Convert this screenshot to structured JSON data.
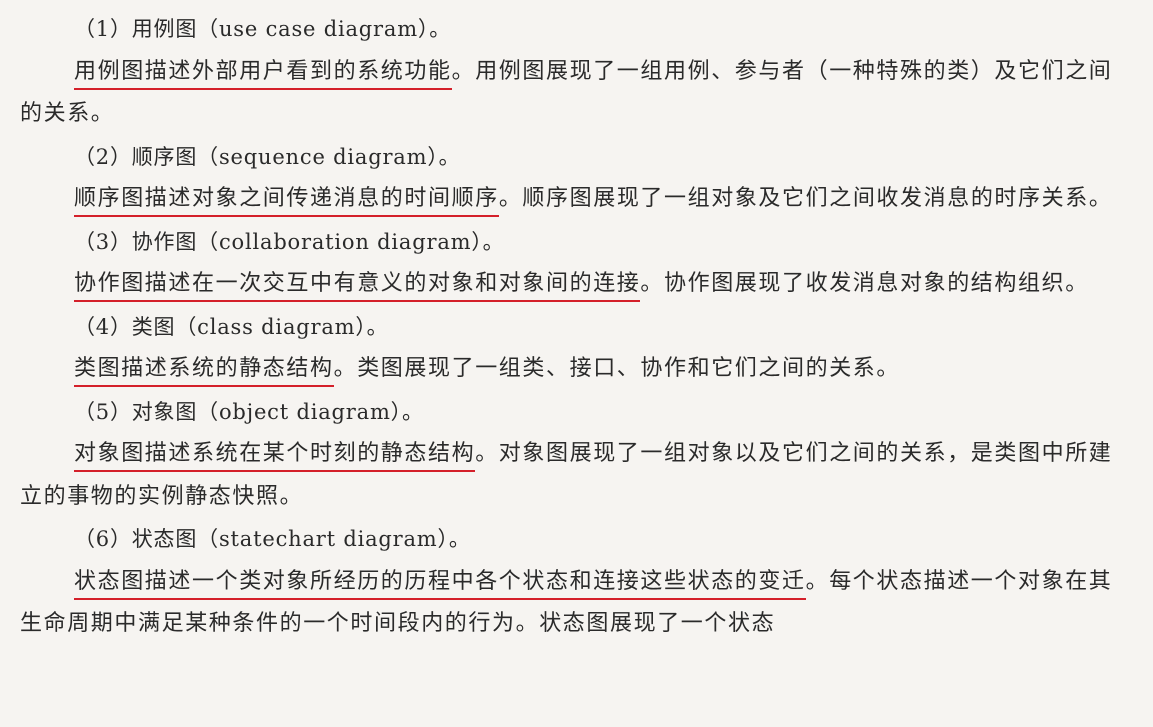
{
  "sections": [
    {
      "heading": "（1）用例图（use case diagram）。",
      "highlight": "用例图描述外部用户看到的系统功能",
      "rest": "。用例图展现了一组用例、参与者（一种特殊的类）及它们之间的关系。"
    },
    {
      "heading": "（2）顺序图（sequence diagram）。",
      "highlight": "顺序图描述对象之间传递消息的时间顺序",
      "rest": "。顺序图展现了一组对象及它们之间收发消息的时序关系。"
    },
    {
      "heading": "（3）协作图（collaboration diagram）。",
      "highlight": "协作图描述在一次交互中有意义的对象和对象间的连接",
      "rest": "。协作图展现了收发消息对象的结构组织。"
    },
    {
      "heading": "（4）类图（class diagram）。",
      "highlight": "类图描述系统的静态结构",
      "rest": "。类图展现了一组类、接口、协作和它们之间的关系。"
    },
    {
      "heading": "（5）对象图（object diagram）。",
      "highlight": "对象图描述系统在某个时刻的静态结构",
      "rest": "。对象图展现了一组对象以及它们之间的关系，是类图中所建立的事物的实例静态快照。"
    },
    {
      "heading": "（6）状态图（statechart diagram）。",
      "highlight": "状态图描述一个类对象所经历的历程中各个状态和连接这些状态的变迁",
      "rest": "。每个状态描述一个对象在其生命周期中满足某种条件的一个时间段内的行为。状态图展现了一个状态"
    }
  ],
  "colors": {
    "underline": "#d4202a",
    "text": "#2a2a2a",
    "paper": "#f6f4f1"
  }
}
